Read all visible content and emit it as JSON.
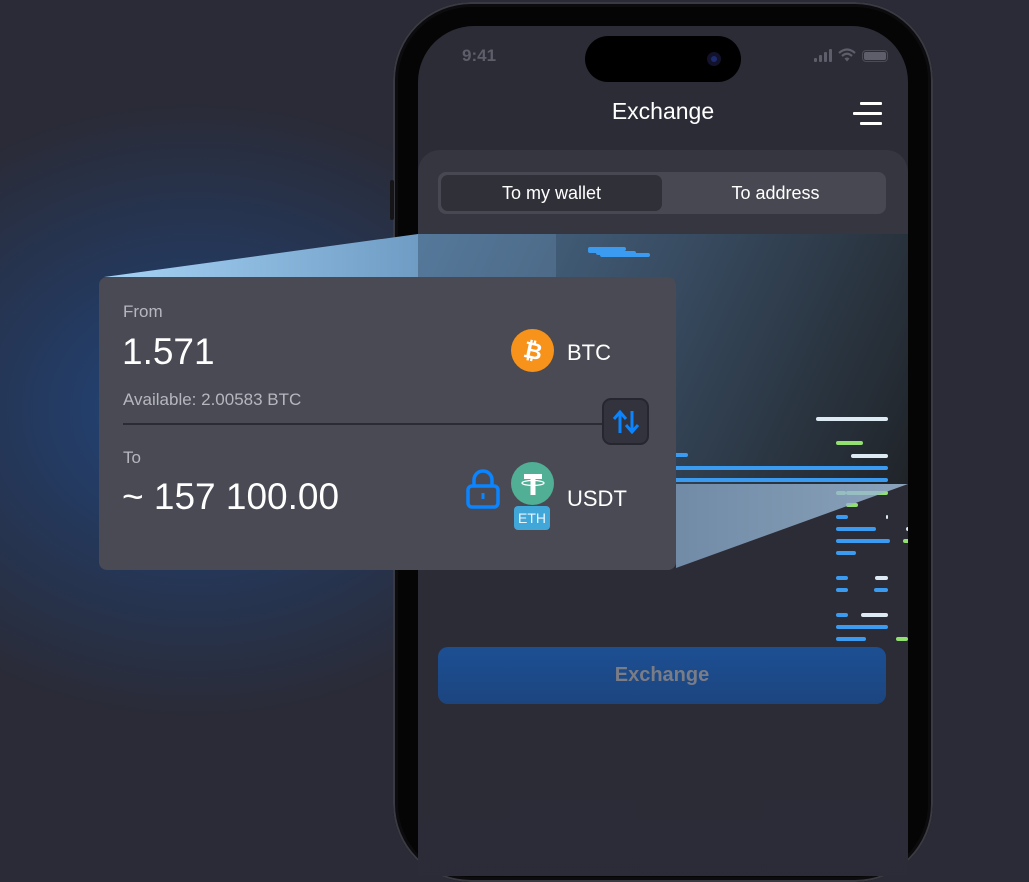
{
  "status_bar": {
    "time": "9:41"
  },
  "header": {
    "title": "Exchange",
    "menu_icon": "hamburger-menu-icon"
  },
  "tabs": [
    {
      "label": "To my wallet",
      "active": true
    },
    {
      "label": "To address",
      "active": false
    }
  ],
  "exchange_card": {
    "from": {
      "label": "From",
      "amount": "1.571",
      "currency": "BTC",
      "currency_icon": "bitcoin-icon",
      "available": "Available: 2.00583 BTC"
    },
    "swap_icon": "swap-arrows-icon",
    "to": {
      "label": "To",
      "amount": "~ 157 100.00",
      "currency": "USDT",
      "currency_icon": "tether-icon",
      "network_badge": "ETH",
      "lock_icon": "lock-icon"
    }
  },
  "exchange_button": {
    "label": "Exchange"
  },
  "colors": {
    "background": "#2a2b37",
    "card": "#494a54",
    "accent_blue": "#0a84ff",
    "bitcoin": "#f7931a",
    "tether": "#50af95",
    "eth_badge": "#41a7d9",
    "button": "#1c4f93"
  }
}
